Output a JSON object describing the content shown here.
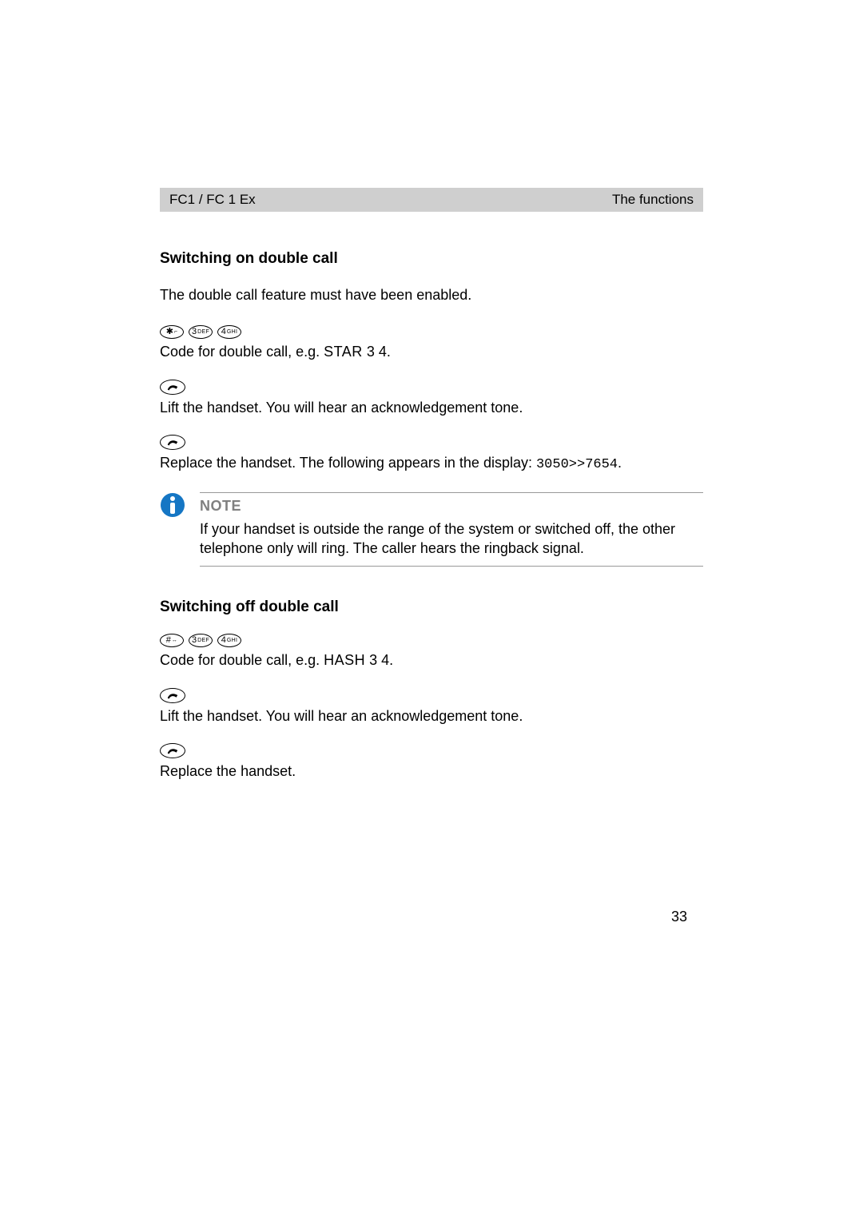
{
  "header": {
    "left": "FC1 / FC 1 Ex",
    "right": "The functions"
  },
  "section1": {
    "title": "Switching on double call",
    "intro": "The double call feature must have been enabled.",
    "step1": {
      "text_pre": "Code for double call, e.g. ",
      "text_small": "STAR",
      "text_post": " 3 4."
    },
    "step2": "Lift the handset. You will hear an acknowledgement tone.",
    "step3": {
      "pre": "Replace the handset. The following appears in the display: ",
      "code": "3050>>7654",
      "post": "."
    }
  },
  "note": {
    "label": "NOTE",
    "text": "If your handset is outside the range of the system or switched off, the other telephone only will ring. The caller hears the ringback signal."
  },
  "section2": {
    "title": "Switching off double call",
    "step1": {
      "text_pre": "Code for double call, e.g. ",
      "text_small": "HASH",
      "text_post": " 3 4."
    },
    "step2": "Lift the handset. You will hear an acknowledgement tone.",
    "step3": "Replace the handset."
  },
  "keys": {
    "star": "✱",
    "star_sub": "⌐",
    "hash": "#",
    "hash_sub": "↔",
    "three": "3",
    "three_sub": "DEF",
    "four": "4",
    "four_sub": "GHI"
  },
  "page_number": "33"
}
